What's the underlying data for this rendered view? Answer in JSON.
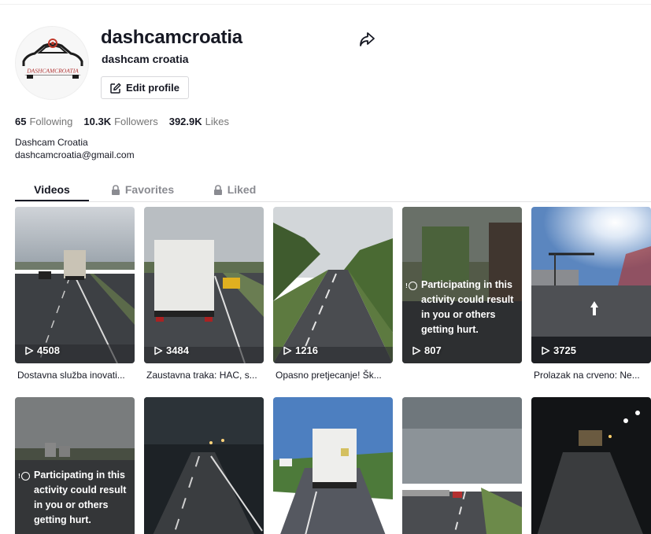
{
  "profile": {
    "username": "dashcamcroatia",
    "nickname": "dashcam croatia",
    "edit_label": "Edit profile",
    "avatar_text": "DASHCAMCROATIA",
    "bio_line1": "Dashcam Croatia",
    "bio_line2": "dashcamcroatia@gmail.com"
  },
  "stats": {
    "following_count": "65",
    "following_label": "Following",
    "followers_count": "10.3K",
    "followers_label": "Followers",
    "likes_count": "392.9K",
    "likes_label": "Likes"
  },
  "tabs": {
    "videos": "Videos",
    "favorites": "Favorites",
    "liked": "Liked"
  },
  "warning_text": "Participating in this activity could result in you or others getting hurt.",
  "videos": [
    {
      "views": "4508",
      "caption": "Dostavna služba inovati..."
    },
    {
      "views": "3484",
      "caption": "Zaustavna traka: HAC, s..."
    },
    {
      "views": "1216",
      "caption": "Opasno pretjecanje! Šk..."
    },
    {
      "views": "807",
      "caption": ""
    },
    {
      "views": "3725",
      "caption": "Prolazak na crveno: Ne..."
    },
    {
      "views": "",
      "caption": ""
    },
    {
      "views": "",
      "caption": ""
    },
    {
      "views": "",
      "caption": ""
    },
    {
      "views": "",
      "caption": ""
    },
    {
      "views": "",
      "caption": ""
    }
  ],
  "icons": {
    "share": "share-arrow-icon",
    "edit": "edit-pencil-icon",
    "lock": "lock-icon",
    "play": "play-triangle-icon",
    "info": "info-circle-icon"
  }
}
